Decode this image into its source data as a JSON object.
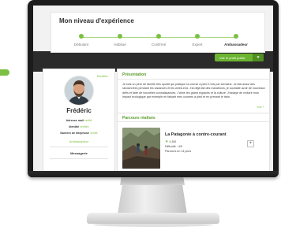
{
  "level": {
    "title": "Mon niveau d'expérience",
    "steps": [
      "Débutant",
      "Habitué",
      "Confirmé",
      "Expert",
      "Ambassadeur"
    ],
    "current_index": 4
  },
  "actions": {
    "profile_button": "Voir le profil public",
    "profile_arrow": "»"
  },
  "profile": {
    "edit": "Modifier",
    "name": "Frédéric",
    "email_label": "Adresse mail",
    "email_status": "vérifié",
    "identity_label": "Identité",
    "identity_status": "vérifiée",
    "phone_label": "Numéro de téléphone",
    "phone_status": "vérifié",
    "badge": "Ambassadeur",
    "messaging": "Messagerie"
  },
  "presentation": {
    "title": "Présentation",
    "text": "Je suis un père de famille très sportif qui pratique la course à pied 3 fois par semaine. Je fais aussi des randonnées pendant les vacances et les week-end. J'ai déjà fait des marathons, je souhaite avoir de nouveaux défis et faire de nouvelles connaissances. J'aime les grand espaces et la culture. J'essaye de réduire mon impact écologique par exemple en faisant mes courses à pied et en prenant le train.",
    "more": "Voir +"
  },
  "parcours": {
    "title": "Parcours réalisés",
    "trip": {
      "title": "La Patagonie à contre-courant",
      "rating": "4,5/5",
      "difficulty": "Difficulté : 4/5",
      "duration": "Parcours en 14 jours",
      "add": "+"
    }
  },
  "colors": {
    "accent": "#7bc043",
    "accent_dark": "#4f8e22",
    "band": "#2b2b2b"
  }
}
